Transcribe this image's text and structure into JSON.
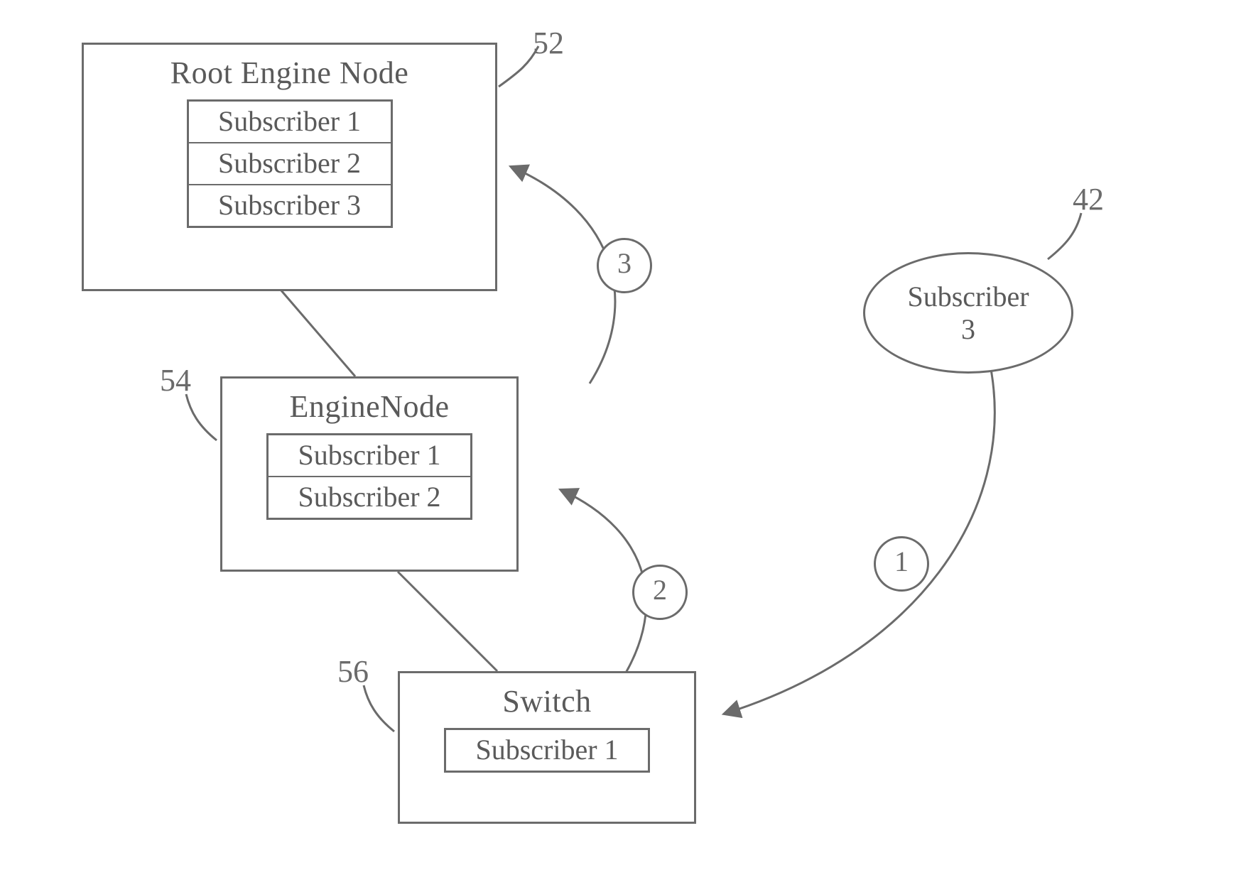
{
  "nodes": {
    "root": {
      "title": "Root Engine Node",
      "ref": "52",
      "subscribers": [
        "Subscriber 1",
        "Subscriber 2",
        "Subscriber 3"
      ]
    },
    "engine": {
      "title": "EngineNode",
      "ref": "54",
      "subscribers": [
        "Subscriber 1",
        "Subscriber 2"
      ]
    },
    "switch": {
      "title": "Switch",
      "ref": "56",
      "subscribers": [
        "Subscriber 1"
      ]
    },
    "subscriber_ellipse": {
      "line1": "Subscriber",
      "line2": "3",
      "ref": "42"
    }
  },
  "steps": {
    "one": "1",
    "two": "2",
    "three": "3"
  }
}
